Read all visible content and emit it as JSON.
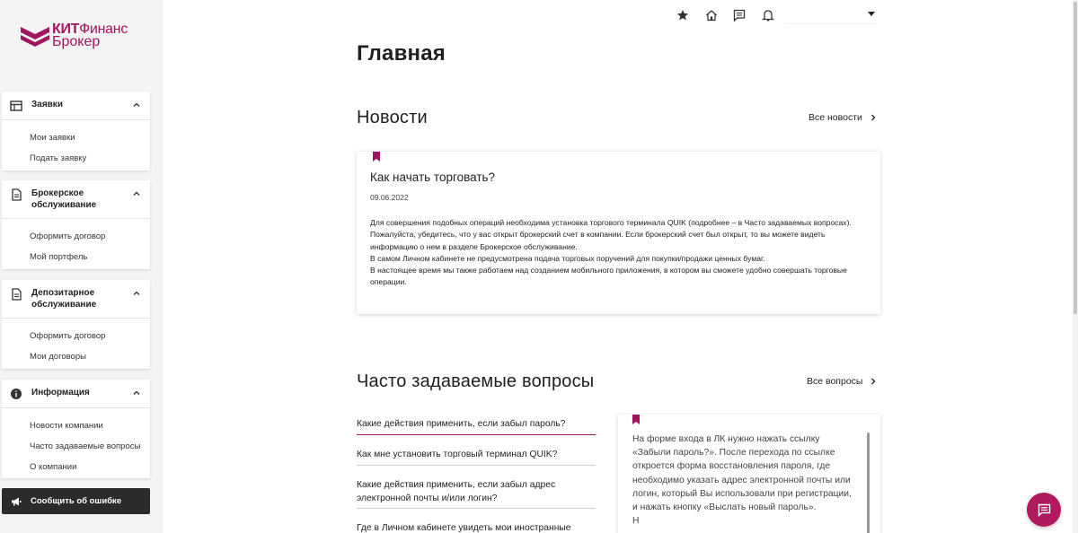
{
  "brand": {
    "name_bold": "КИТ",
    "name_rest": "Финанс",
    "name_sub": "Брокер",
    "color": "#a01560"
  },
  "sidebar": {
    "groups": [
      {
        "title": "Заявки",
        "icon": "table-icon",
        "items": [
          "Мои заявки",
          "Подать заявку"
        ]
      },
      {
        "title": "Брокерское обслуживание",
        "icon": "document-icon",
        "items": [
          "Оформить договор",
          "Мой портфель"
        ]
      },
      {
        "title": "Депозитарное обслуживание",
        "icon": "document-icon",
        "items": [
          "Оформить договор",
          "Мои договоры"
        ]
      },
      {
        "title": "Информация",
        "icon": "info-icon",
        "items": [
          "Новости компании",
          "Часто задаваемые вопросы",
          "О компании"
        ]
      }
    ],
    "report_button": "Сообщить об ошибке"
  },
  "topbar": {
    "icons": [
      "star-icon",
      "home-icon",
      "chat-icon",
      "bell-icon"
    ],
    "account_value": ""
  },
  "main": {
    "title": "Главная",
    "news": {
      "heading": "Новости",
      "all_link": "Все новости",
      "card": {
        "title": "Как начать торговать?",
        "date": "09.06.2022",
        "paragraphs": [
          "Для совершения подобных операций необходима установка торгового терминала QUIK (подробнее – в Часто задаваемых вопросах).",
          "Пожалуйста, убедитесь, что у вас открыт брокерский счет в компании. Если брокерский счет был открыт, то вы можете видеть информацию о нем в разделе Брокерское обслуживание.",
          "В самом Личном кабинете не предусмотрена подача торговых поручений для покупки/продажи ценных бумаг.",
          "В настоящее время мы также работаем над созданием мобильного приложения, в котором вы сможете удобно совершать торговые операции."
        ]
      }
    },
    "faq": {
      "heading": "Часто задаваемые вопросы",
      "all_link": "Все вопросы",
      "questions": [
        "Какие действия применить, если забыл пароль?",
        "Как мне установить торговый терминал QUIK?",
        "Какие действия применить, если забыл адрес электронной почты и/или логин?",
        "Где в Личном кабинете увидеть мои иностранные"
      ],
      "answer": "На форме входа в ЛК нужно нажать ссылку «Забыли пароль?». После перехода по ссылке откроется форма восстановления пароля, где необходимо указать адрес электронной почты или логин, который Вы использовали при регистрации, и нажать кнопку «Выслать новый пароль».",
      "answer_tail": "Н"
    }
  },
  "colors": {
    "accent": "#a01560",
    "fab": "#b2195e",
    "dark_button": "#2b2b2b"
  }
}
